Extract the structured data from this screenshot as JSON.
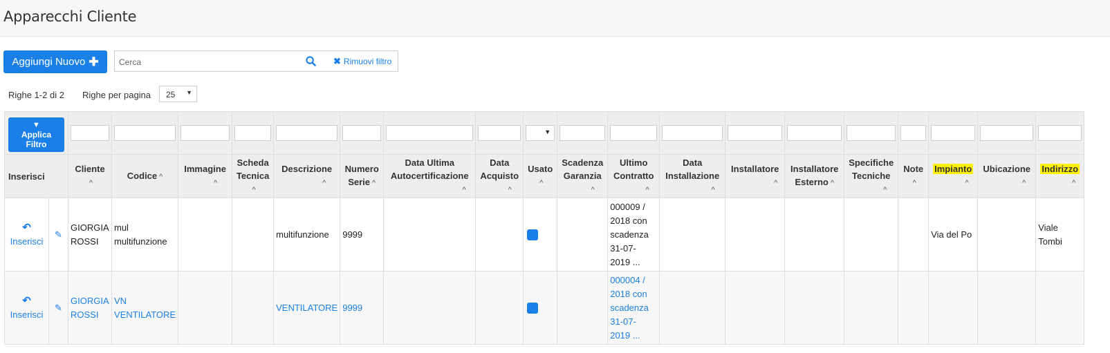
{
  "page": {
    "title": "Apparecchi Cliente"
  },
  "toolbar": {
    "add_label": "Aggiungi Nuovo",
    "search_placeholder": "Cerca",
    "remove_filter_label": "Rimuovi filtro"
  },
  "pagination": {
    "rows_info": "Righe 1-2 di 2",
    "rows_per_page_label": "Righe per pagina",
    "rows_per_page_value": "25"
  },
  "grid": {
    "apply_filter_label_1": "Applica",
    "apply_filter_label_2": "Filtro",
    "headers": {
      "inserisci": "Inserisci",
      "cliente": "Cliente",
      "codice": "Codice",
      "immagine": "Immagine",
      "scheda_1": "Scheda",
      "scheda_2": "Tecnica",
      "descrizione": "Descrizione",
      "numero_1": "Numero",
      "numero_2": "Serie",
      "data_auto_1": "Data Ultima",
      "data_auto_2": "Autocertificazione",
      "data_acq_1": "Data",
      "data_acq_2": "Acquisto",
      "usato": "Usato",
      "scad_1": "Scadenza",
      "scad_2": "Garanzia",
      "ultimo_1": "Ultimo",
      "ultimo_2": "Contratto",
      "data_inst_1": "Data",
      "data_inst_2": "Installazione",
      "installatore": "Installatore",
      "inst_est_1": "Installatore",
      "inst_est_2": "Esterno",
      "spec_1": "Specifiche",
      "spec_2": "Tecniche",
      "note": "Note",
      "impianto": "Impianto",
      "ubicazione": "Ubicazione",
      "indirizzo": "Indirizzo"
    },
    "rows": [
      {
        "inserisci": "Inserisci",
        "cliente_1": "GIORGIA",
        "cliente_2": "ROSSI",
        "codice_1": "mul",
        "codice_2": "multifunzione",
        "descrizione": "multifunzione",
        "numero_serie": "9999",
        "contratto_1": "000009 /",
        "contratto_2": "2018 con",
        "contratto_3": "scadenza",
        "contratto_4": "31-07-",
        "contratto_5": "2019 ...",
        "impianto": "Via del Po",
        "indirizzo_1": "Viale",
        "indirizzo_2": "Tombi"
      },
      {
        "inserisci": "Inserisci",
        "cliente_1": "GIORGIA",
        "cliente_2": "ROSSI",
        "codice_1": "VN",
        "codice_2": "VENTILATORE",
        "descrizione": "VENTILATORE",
        "numero_serie": "9999",
        "contratto_1": "000004 /",
        "contratto_2": "2018 con",
        "contratto_3": "scadenza",
        "contratto_4": "31-07-",
        "contratto_5": "2019 ..."
      }
    ]
  },
  "colors": {
    "accent": "#1a7fe6",
    "highlight": "#fff200"
  }
}
